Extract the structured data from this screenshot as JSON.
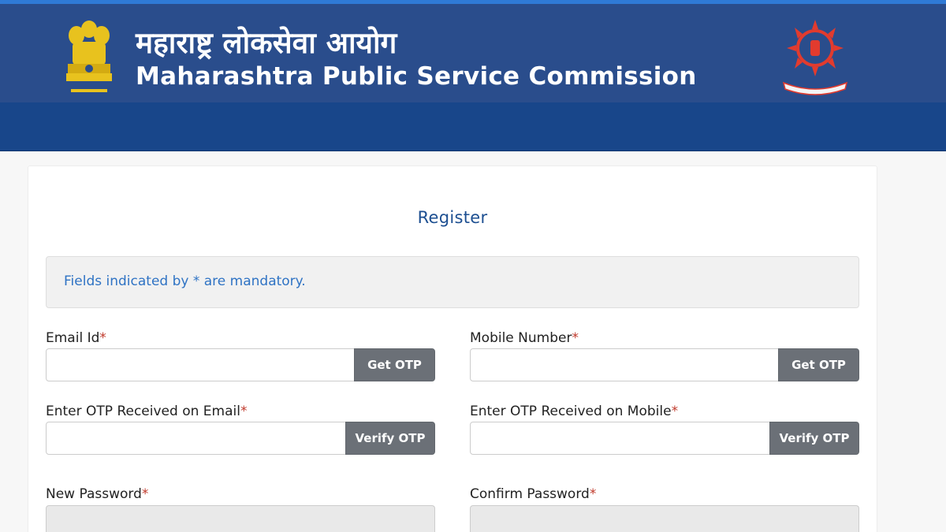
{
  "header": {
    "title_marathi": "महाराष्ट्र लोकसेवा आयोग",
    "title_english": "Maharashtra Public Service Commission",
    "brand_color": "#2a4d8c",
    "band_color": "#18468a"
  },
  "form": {
    "title": "Register",
    "notice": "Fields indicated by * are mandatory.",
    "required_mark": "*",
    "email_label": "Email Id",
    "mobile_label": "Mobile Number",
    "email_otp_label": "Enter OTP Received on Email",
    "mobile_otp_label": "Enter OTP Received on Mobile",
    "new_password_label": "New Password",
    "confirm_password_label": "Confirm Password",
    "get_otp_label": "Get OTP",
    "verify_otp_label": "Verify OTP",
    "email_value": "",
    "mobile_value": "",
    "email_otp_value": "",
    "mobile_otp_value": ""
  },
  "icons": {
    "left_emblem": "national-emblem-icon",
    "right_seal": "mpsc-seal-icon"
  }
}
